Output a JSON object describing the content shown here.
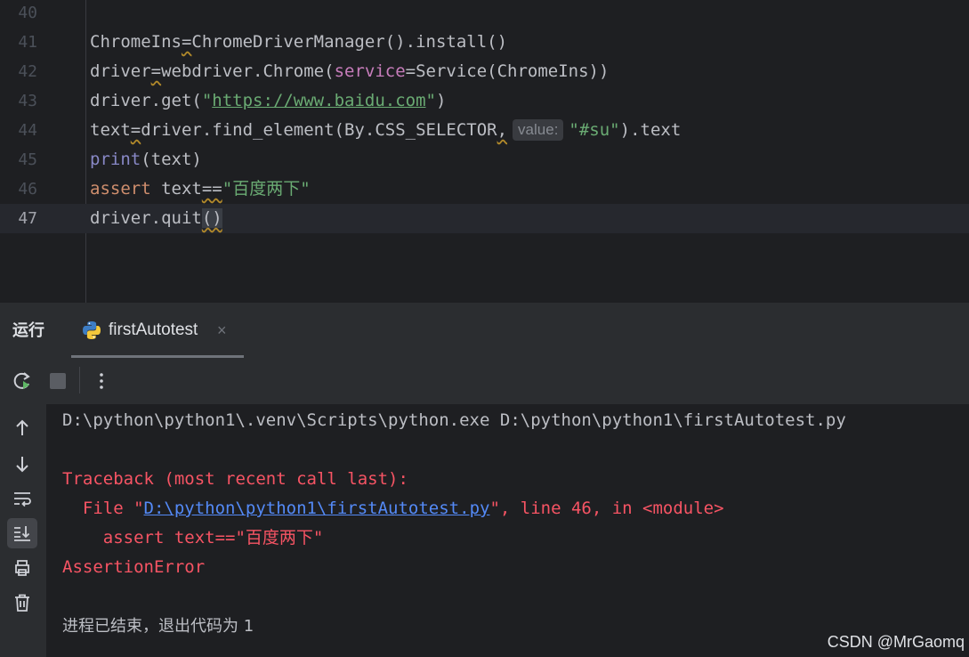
{
  "editor": {
    "lines": [
      {
        "number": "40"
      },
      {
        "number": "41",
        "parts": {
          "a": "ChromeIns",
          "b": "=",
          "c": "ChromeDriverManager().install()"
        }
      },
      {
        "number": "42",
        "parts": {
          "a": "driver",
          "b": "=",
          "c": "webdriver.Chrome(",
          "d": "service",
          "e": "=Service(ChromeIns))"
        }
      },
      {
        "number": "43",
        "parts": {
          "a": "driver.get(",
          "b": "\"",
          "c": "https://www.baidu.com",
          "d": "\"",
          "e": ")"
        }
      },
      {
        "number": "44",
        "parts": {
          "a": "text",
          "b": "=",
          "c": "driver.find_element(By.CSS_SELECTOR",
          "d": ",",
          "hint": "value:",
          "e": "\"#su\"",
          "f": ").text"
        }
      },
      {
        "number": "45",
        "parts": {
          "a": "print",
          "b": "(text)"
        }
      },
      {
        "number": "46",
        "parts": {
          "a": "assert",
          "b": " text",
          "c": "==",
          "d": "\"",
          "e": "百度两下",
          "f": "\""
        }
      },
      {
        "number": "47",
        "parts": {
          "a": "driver.quit",
          "b": "()"
        }
      }
    ]
  },
  "run_panel": {
    "title": "运行",
    "tab_label": "firstAutotest",
    "tab_close": "×"
  },
  "console": {
    "command": "D:\\python\\python1\\.venv\\Scripts\\python.exe D:\\python\\python1\\firstAutotest.py",
    "traceback_header": "Traceback (most recent call last):",
    "file_prefix": "  File \"",
    "file_link": "D:\\python\\python1\\firstAutotest.py",
    "file_suffix": "\", line 46, in <module>",
    "assert_code": "    assert text==\"",
    "assert_text": "百度两下",
    "assert_end": "\"",
    "error": "AssertionError",
    "exit_message": "进程已结束，退出代码为 1"
  },
  "watermark": "CSDN @MrGaomq",
  "icons": {
    "tab": "python-icon",
    "toolbar": [
      "rerun-icon",
      "stop-icon",
      "more-options-icon"
    ],
    "side": [
      "arrow-up-icon",
      "arrow-down-icon",
      "soft-wrap-icon",
      "scroll-to-end-icon",
      "print-icon",
      "trash-icon"
    ]
  },
  "colors": {
    "background": "#1e1f22",
    "panel": "#2b2d30",
    "keyword": "#cf8e6d",
    "string": "#6aab73",
    "error": "#f75464",
    "link": "#548af7"
  }
}
